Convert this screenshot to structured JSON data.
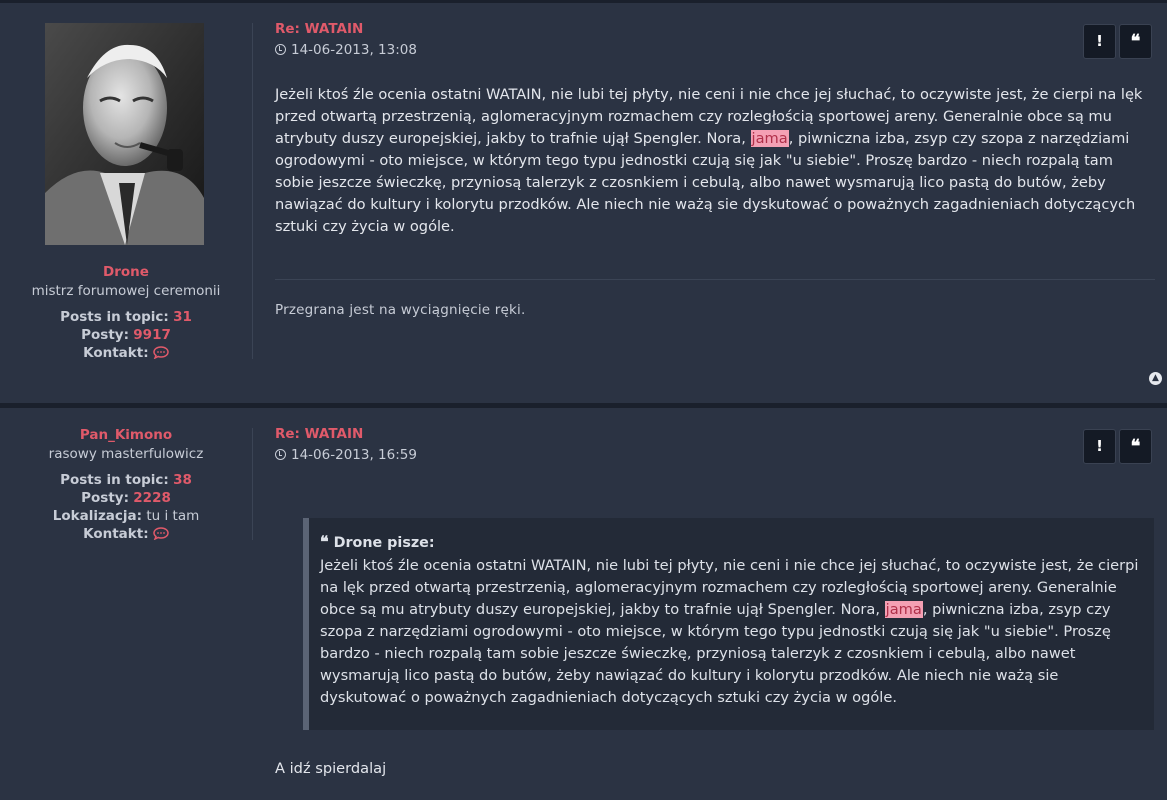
{
  "posts": [
    {
      "author": "Drone",
      "rank": "mistrz forumowej ceremonii",
      "stats": {
        "posts_in_topic_label": "Posts in topic:",
        "posts_in_topic": "31",
        "posts_label": "Posty:",
        "posts": "9917",
        "contact_label": "Kontakt:"
      },
      "title": "Re: WATAIN",
      "date": "14-06-2013, 13:08",
      "body_before": "Jeżeli ktoś źle ocenia ostatni WATAIN, nie lubi tej płyty, nie ceni i nie chce jej słuchać, to oczywiste jest, że cierpi na lęk przed otwartą przestrzenią, aglomeracyjnym rozmachem czy rozległością sportowej areny. Generalnie obce są mu atrybuty duszy europejskiej, jakby to trafnie ujął Spengler. Nora, ",
      "highlight": "jama",
      "body_after": ", piwniczna izba, zsyp czy szopa z narzędziami ogrodowymi - oto miejsce, w którym tego typu jednostki czują się jak \"u siebie\". Proszę bardzo - niech rozpalą tam sobie jeszcze świeczkę, przyniosą talerzyk z czosnkiem i cebulą, albo nawet wysmarują lico pastą do butów, żeby nawiązać do kultury i kolorytu przodków. Ale niech nie ważą sie dyskutować o poważnych zagadnieniach dotyczących sztuki czy życia w ogóle.",
      "signature": "Przegrana jest na wyciągnięcie ręki."
    },
    {
      "author": "Pan_Kimono",
      "rank": "rasowy masterfulowicz",
      "stats": {
        "posts_in_topic_label": "Posts in topic:",
        "posts_in_topic": "38",
        "posts_label": "Posty:",
        "posts": "2228",
        "location_label": "Lokalizacja:",
        "location": "tu i tam",
        "contact_label": "Kontakt:"
      },
      "title": "Re: WATAIN",
      "date": "14-06-2013, 16:59",
      "quote_author": "Drone pisze:",
      "quote_before": "Jeżeli ktoś źle ocenia ostatni WATAIN, nie lubi tej płyty, nie ceni i nie chce jej słuchać, to oczywiste jest, że cierpi na lęk przed otwartą przestrzenią, aglomeracyjnym rozmachem czy rozległością sportowej areny. Generalnie obce są mu atrybuty duszy europejskiej, jakby to trafnie ujął Spengler. Nora, ",
      "quote_highlight": "jama",
      "quote_after": ", piwniczna izba, zsyp czy szopa z narzędziami ogrodowymi - oto miejsce, w którym tego typu jednostki czują się jak \"u siebie\". Proszę bardzo - niech rozpalą tam sobie jeszcze świeczkę, przyniosą talerzyk z czosnkiem i cebulą, albo nawet wysmarują lico pastą do butów, żeby nawiązać do kultury i kolorytu przodków. Ale niech nie ważą sie dyskutować o poważnych zagadnieniach dotyczących sztuki czy życia w ogóle.",
      "reply": "A idź spierdalaj"
    }
  ],
  "buttons": {
    "report_label": "!",
    "quote_label": "❝"
  },
  "icons": {
    "clock": "clock-icon",
    "contact": "speech-bubble-icon",
    "top": "arrow-up-circle-icon"
  },
  "colors": {
    "accent": "#e05a6a",
    "background": "#2b3343",
    "highlight": "#f4a0b4"
  }
}
